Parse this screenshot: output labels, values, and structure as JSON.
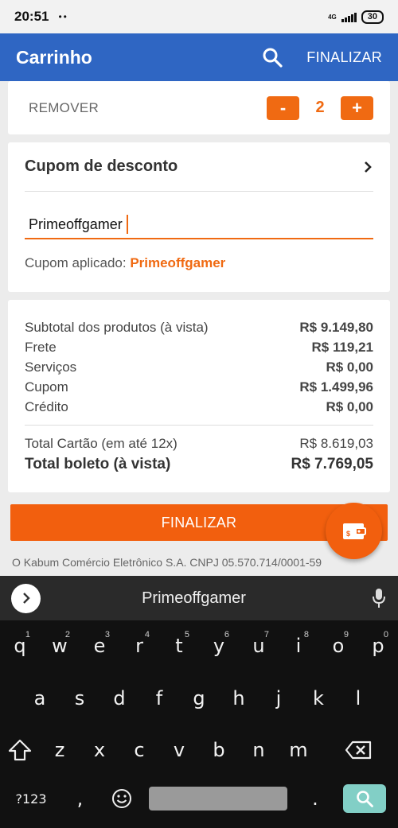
{
  "status_bar": {
    "time": "20:51",
    "dots": "••",
    "network": "4G",
    "battery": "30"
  },
  "app_bar": {
    "title": "Carrinho",
    "finalize_label": "FINALIZAR"
  },
  "item": {
    "remove_label": "REMOVER",
    "minus_label": "-",
    "quantity": "2",
    "plus_label": "+"
  },
  "coupon": {
    "title": "Cupom de desconto",
    "input_value": "Primeoffgamer",
    "applied_label": "Cupom aplicado:",
    "applied_value": "Primeoffgamer"
  },
  "summary": {
    "rows": [
      {
        "label": "Subtotal dos produtos (à vista)",
        "value": "R$ 9.149,80"
      },
      {
        "label": "Frete",
        "value": "R$ 119,21"
      },
      {
        "label": "Serviços",
        "value": "R$ 0,00"
      },
      {
        "label": "Cupom",
        "value": "R$ 1.499,96"
      },
      {
        "label": "Crédito",
        "value": "R$ 0,00"
      }
    ],
    "card_total_label": "Total Cartão (em até 12x)",
    "card_total_value": "R$ 8.619,03",
    "boleto_total_label": "Total boleto (à vista)",
    "boleto_total_value": "R$ 7.769,05"
  },
  "finalize_button": "FINALIZAR",
  "footer_text": "O Kabum Comércio Eletrônico S.A. CNPJ 05.570.714/0001-59",
  "keyboard": {
    "suggestion": "Primeoffgamer",
    "row1": [
      {
        "k": "q",
        "n": "1"
      },
      {
        "k": "w",
        "n": "2"
      },
      {
        "k": "e",
        "n": "3"
      },
      {
        "k": "r",
        "n": "4"
      },
      {
        "k": "t",
        "n": "5"
      },
      {
        "k": "y",
        "n": "6"
      },
      {
        "k": "u",
        "n": "7"
      },
      {
        "k": "i",
        "n": "8"
      },
      {
        "k": "o",
        "n": "9"
      },
      {
        "k": "p",
        "n": "0"
      }
    ],
    "row2": [
      "a",
      "s",
      "d",
      "f",
      "g",
      "h",
      "j",
      "k",
      "l"
    ],
    "row3": [
      "z",
      "x",
      "c",
      "v",
      "b",
      "n",
      "m"
    ],
    "symbols_key": "?123",
    "comma_key": ",",
    "period_key": "."
  },
  "colors": {
    "primary": "#2f66c3",
    "accent": "#f06a12",
    "keyboard_bg": "#111111",
    "search_key": "#82cfc6"
  }
}
